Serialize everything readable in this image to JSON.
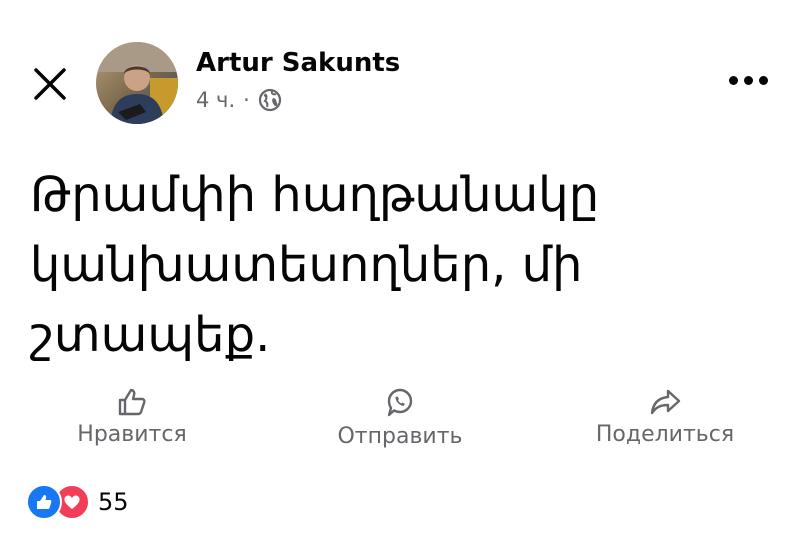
{
  "header": {
    "author_name": "Artur Sakunts",
    "time": "4 ч.",
    "separator": "·",
    "privacy_icon": "globe-icon"
  },
  "post": {
    "lines": [
      "Թրամփի հաղթանակը",
      "կանխատեսողներ, մի",
      "շտապեք."
    ]
  },
  "actions": {
    "like_label": "Нравится",
    "send_label": "Отправить",
    "share_label": "Поделиться"
  },
  "reactions": {
    "count": "55",
    "icons": [
      "like-reaction-icon",
      "love-reaction-icon"
    ]
  },
  "colors": {
    "text": "#050505",
    "secondary": "#65676b",
    "like_blue": "#1877f2",
    "love_red": "#f33e58"
  }
}
